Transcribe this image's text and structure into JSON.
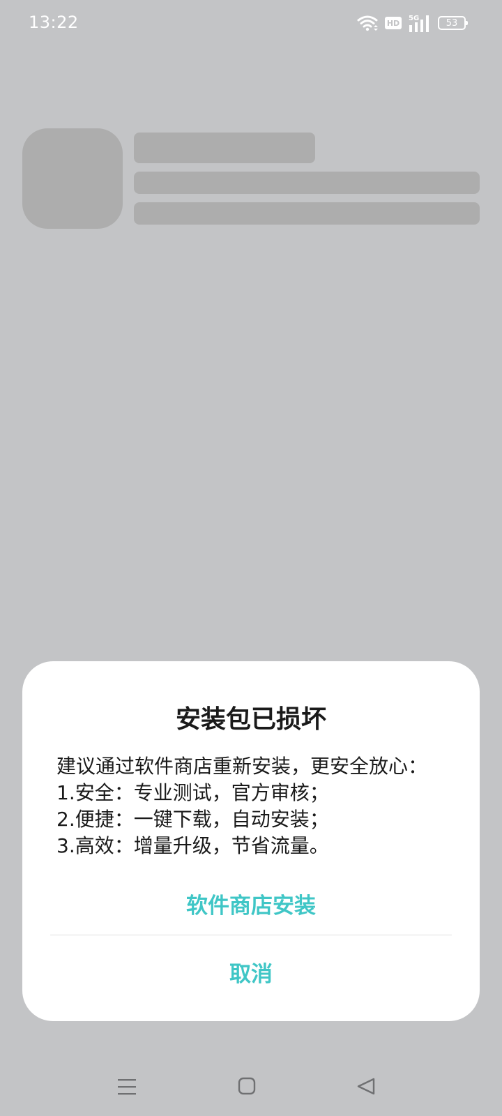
{
  "status_bar": {
    "time": "13:22",
    "network_label": "5G",
    "hd_label": "HD",
    "battery_level": "53"
  },
  "dialog": {
    "title": "安装包已损坏",
    "body_lines": [
      "建议通过软件商店重新安装，更安全放心：",
      "1.安全：专业测试，官方审核；",
      "2.便捷：一键下载，自动安装；",
      "3.高效：增量升级，节省流量。"
    ],
    "primary_button": "软件商店安装",
    "cancel_button": "取消"
  },
  "colors": {
    "accent": "#3fc6c6",
    "backdrop": "#c3c4c6",
    "skeleton": "#adadad"
  },
  "icons": {
    "wifi": "wifi-icon",
    "signal": "cellular-signal-icon",
    "battery": "battery-icon",
    "nav_menu": "menu-icon",
    "nav_home": "home-square-icon",
    "nav_back": "back-triangle-icon"
  }
}
